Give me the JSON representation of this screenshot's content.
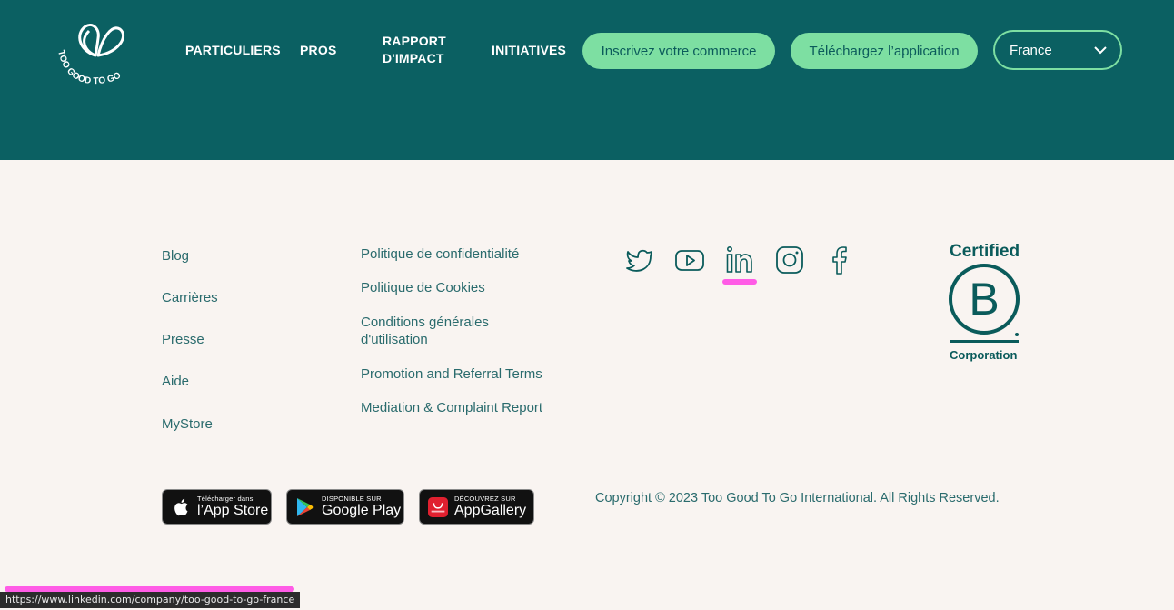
{
  "header": {
    "logo_text": "TOO GOOD TO GO",
    "nav": [
      "PARTICULIERS",
      "PROS",
      "RAPPORT D'IMPACT",
      "INITIATIVES"
    ],
    "nav_rapport_line1": "RAPPORT",
    "nav_rapport_line2": "D'IMPACT",
    "cta_register": "Inscrivez votre commerce",
    "cta_download": "Téléchargez l’application",
    "country_selected": "France"
  },
  "footer": {
    "col1": [
      "Blog",
      "Carrières",
      "Presse",
      "Aide",
      "MyStore"
    ],
    "col2": [
      "Politique de confidentialité",
      "Politique de Cookies",
      "Conditions générales d'utilisation",
      "Promotion and Referral Terms",
      "Mediation & Complaint Report"
    ],
    "social_icons": [
      "twitter-icon",
      "youtube-icon",
      "linkedin-icon",
      "instagram-icon",
      "facebook-icon"
    ],
    "bcorp": {
      "top": "Certified",
      "letter": "B",
      "bottom": "Corporation"
    },
    "badges": {
      "appstore_small": "Télécharger dans",
      "appstore_big": "l’App Store",
      "googleplay_small": "DISPONIBLE SUR",
      "googleplay_big": "Google Play",
      "appgallery_small": "DÉCOUVREZ SUR",
      "appgallery_big": "AppGallery"
    },
    "copyright": "Copyright © 2023 Too Good To Go International. All Rights Reserved."
  },
  "status_bar": {
    "url": "https://www.linkedin.com/company/too-good-to-go-france"
  },
  "colors": {
    "header_bg": "#0b6062",
    "accent_green": "#7ddfa2",
    "page_bg": "#f9f4f1",
    "text_teal": "#0a5b5b",
    "highlight": "#ff5ce6"
  }
}
